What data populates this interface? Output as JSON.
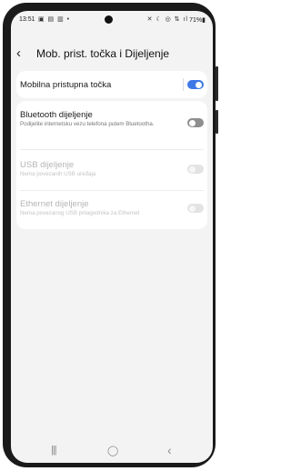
{
  "status_bar": {
    "time": "13:51",
    "left_icons": "▣ ▤ ▥ •",
    "right_icons": "✕ ☾ ◎ ⇅ ıl",
    "battery": "71%▮"
  },
  "header": {
    "back_icon": "‹",
    "title": "Mob. prist. točka i Dijeljenje"
  },
  "settings": [
    {
      "label": "Mobilna pristupna točka",
      "subtitle": "",
      "enabled": true,
      "on": true
    },
    {
      "label": "Bluetooth dijeljenje",
      "subtitle": "Podijelite internetsku vezu telefona putem Bluetootha.",
      "enabled": true,
      "on": false
    },
    {
      "label": "USB dijeljenje",
      "subtitle": "Nema povezanih USB uređaja",
      "enabled": false,
      "on": false
    },
    {
      "label": "Ethernet dijeljenje",
      "subtitle": "Nema povezanog USB prilagodnika za Ethernet",
      "enabled": false,
      "on": false
    }
  ],
  "nav": {
    "recents": "|||",
    "home": "◯",
    "back": "‹"
  },
  "colors": {
    "accent": "#3e78e6",
    "background": "#f3f3f3",
    "card": "#ffffff"
  }
}
